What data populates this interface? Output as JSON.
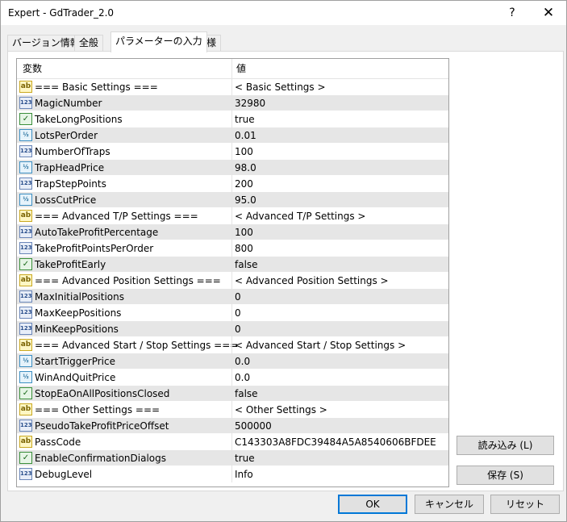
{
  "window": {
    "title": "Expert - GdTrader_2.0",
    "help_glyph": "?",
    "close_glyph": "✕"
  },
  "tabs": [
    {
      "label": "バージョン情報"
    },
    {
      "label": "全般"
    },
    {
      "label": "パラメーターの入力"
    },
    {
      "label": "仕様"
    }
  ],
  "active_tab": "パラメーターの入力",
  "grid": {
    "headers": {
      "name": "変数",
      "value": "値"
    },
    "rows": [
      {
        "icon": "ab",
        "name": "=== Basic Settings ===",
        "value": "< Basic Settings >"
      },
      {
        "icon": "123",
        "name": "MagicNumber",
        "value": "32980"
      },
      {
        "icon": "bool",
        "name": "TakeLongPositions",
        "value": "true"
      },
      {
        "icon": "dbl",
        "name": "LotsPerOrder",
        "value": "0.01"
      },
      {
        "icon": "123",
        "name": "NumberOfTraps",
        "value": "100"
      },
      {
        "icon": "dbl",
        "name": "TrapHeadPrice",
        "value": "98.0"
      },
      {
        "icon": "123",
        "name": "TrapStepPoints",
        "value": "200"
      },
      {
        "icon": "dbl",
        "name": "LossCutPrice",
        "value": "95.0"
      },
      {
        "icon": "ab",
        "name": "=== Advanced T/P Settings ===",
        "value": "< Advanced T/P Settings >"
      },
      {
        "icon": "123",
        "name": "AutoTakeProfitPercentage",
        "value": "100"
      },
      {
        "icon": "123",
        "name": "TakeProfitPointsPerOrder",
        "value": "800"
      },
      {
        "icon": "bool",
        "name": "TakeProfitEarly",
        "value": "false"
      },
      {
        "icon": "ab",
        "name": "=== Advanced Position Settings ===",
        "value": "< Advanced Position Settings >"
      },
      {
        "icon": "123",
        "name": "MaxInitialPositions",
        "value": "0"
      },
      {
        "icon": "123",
        "name": "MaxKeepPositions",
        "value": "0"
      },
      {
        "icon": "123",
        "name": "MinKeepPositions",
        "value": "0"
      },
      {
        "icon": "ab",
        "name": "=== Advanced Start / Stop Settings ===",
        "value": "< Advanced Start / Stop Settings >"
      },
      {
        "icon": "dbl",
        "name": "StartTriggerPrice",
        "value": "0.0"
      },
      {
        "icon": "dbl",
        "name": "WinAndQuitPrice",
        "value": "0.0"
      },
      {
        "icon": "bool",
        "name": "StopEaOnAllPositionsClosed",
        "value": "false"
      },
      {
        "icon": "ab",
        "name": "=== Other Settings ===",
        "value": "< Other Settings >"
      },
      {
        "icon": "123",
        "name": "PseudoTakeProfitPriceOffset",
        "value": "500000"
      },
      {
        "icon": "ab",
        "name": "PassCode",
        "value": "C143303A8FDC39484A5A8540606BFDEE"
      },
      {
        "icon": "bool",
        "name": "EnableConfirmationDialogs",
        "value": "true"
      },
      {
        "icon": "123",
        "name": "DebugLevel",
        "value": "Info"
      }
    ]
  },
  "buttons": {
    "load": "読み込み (L)",
    "save": "保存 (S)",
    "ok": "OK",
    "cancel": "キャンセル",
    "reset": "リセット"
  }
}
